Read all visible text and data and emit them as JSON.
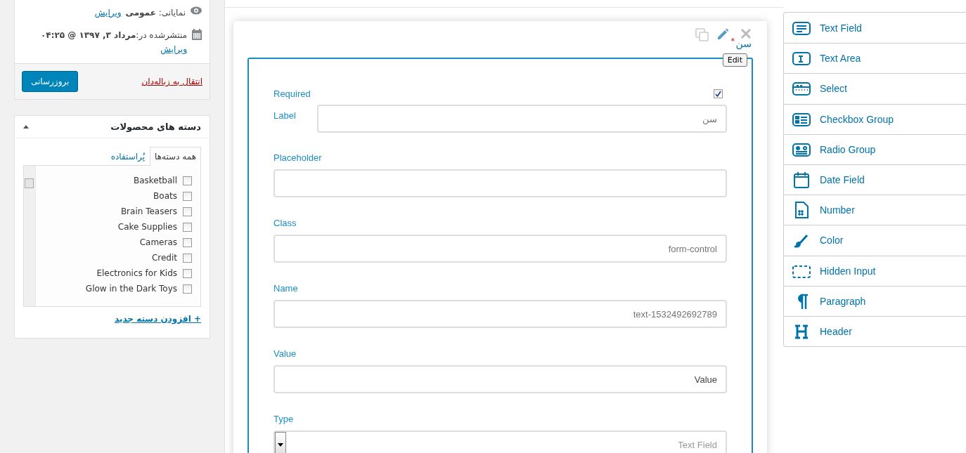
{
  "publish_box": {
    "visibility": {
      "label": "نمایانی: **عمومی**",
      "edit_link": "ویرایش"
    },
    "published": {
      "label": "منتشرشده در:**مرداد ۳, ۱۳۹۷ @ ۰۴:۲۵**",
      "edit_link": "ویرایش"
    },
    "trash_link": "انتقال به زباله‌دان",
    "update_button": "بروزرسانی"
  },
  "categories_box": {
    "title": "دسته های محصولات",
    "expanded": true,
    "tabs": [
      {
        "label": "همه دسته‌ها",
        "selected": true
      },
      {
        "label": "پُراستفاده",
        "selected": false
      }
    ],
    "items": [
      {
        "label": "Basketball",
        "checked": false
      },
      {
        "label": "Boats",
        "checked": false
      },
      {
        "label": "Brain Teasers",
        "checked": false
      },
      {
        "label": "Cake Supplies",
        "checked": false
      },
      {
        "label": "Cameras",
        "checked": false
      },
      {
        "label": "Credit",
        "checked": false
      },
      {
        "label": "Electronics for Kids",
        "checked": false
      },
      {
        "label": "Glow in the Dark Toys",
        "checked": false
      }
    ],
    "add_link": "+ افزودن دسته جدید"
  },
  "field_card": {
    "title": "سن",
    "required_mark": "*",
    "tooltip": "Edit",
    "fields": [
      {
        "kind": "checkbox",
        "label": "Required",
        "checked": true
      },
      {
        "kind": "inline",
        "label": "Label",
        "placeholder": "سن"
      },
      {
        "kind": "stacked",
        "label": "Placeholder"
      },
      {
        "kind": "stacked",
        "label": "Class",
        "placeholder": "form-control"
      },
      {
        "kind": "stacked",
        "label": "Name",
        "placeholder": "text-1532492692789"
      },
      {
        "kind": "stacked",
        "label": "Value",
        "value": "Value"
      },
      {
        "kind": "select",
        "label": "Type",
        "value": "Text Field"
      }
    ]
  },
  "controls": [
    {
      "kind": "text",
      "label": "Text Field"
    },
    {
      "kind": "textarea",
      "label": "Text Area"
    },
    {
      "kind": "select",
      "label": "Select"
    },
    {
      "kind": "checkbox",
      "label": "Checkbox Group"
    },
    {
      "kind": "radio",
      "label": "Radio Group"
    },
    {
      "kind": "date",
      "label": "Date Field"
    },
    {
      "kind": "number",
      "label": "Number"
    },
    {
      "kind": "color",
      "label": "Color"
    },
    {
      "kind": "hidden",
      "label": "Hidden Input"
    },
    {
      "kind": "paragraph",
      "label": "Paragraph"
    },
    {
      "kind": "header",
      "label": "Header"
    }
  ]
}
